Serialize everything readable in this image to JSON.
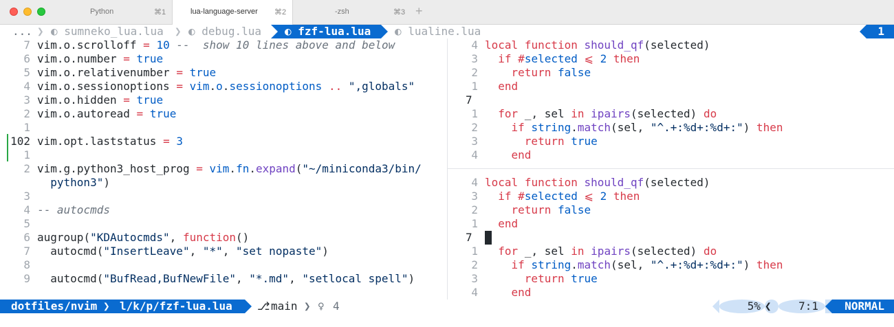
{
  "window": {
    "tabs": [
      {
        "name": "Python",
        "key": "⌘1"
      },
      {
        "name": "lua-language-server",
        "key": "⌘2"
      },
      {
        "name": "-zsh",
        "key": "⌘3"
      }
    ],
    "new_tab": "+"
  },
  "bufferline": {
    "ellipsis": "...",
    "buffers": [
      {
        "icon": "lua-icon",
        "name": "sumneko_lua.lua"
      },
      {
        "icon": "lua-icon",
        "name": "debug.lua"
      },
      {
        "icon": "lua-icon",
        "name": "fzf-lua.lua"
      },
      {
        "icon": "lua-icon",
        "name": "lualine.lua"
      }
    ],
    "count": "1"
  },
  "left_pane": {
    "lines": [
      {
        "ln": "7",
        "code": "vim.o.scrolloff = 10 --  show 10 lines above and below"
      },
      {
        "ln": "6",
        "code": "vim.o.number = true"
      },
      {
        "ln": "5",
        "code": "vim.o.relativenumber = true"
      },
      {
        "ln": "4",
        "code": "vim.o.sessionoptions = vim.o.sessionoptions .. \",globals\""
      },
      {
        "ln": "3",
        "code": "vim.o.hidden = true"
      },
      {
        "ln": "2",
        "code": "vim.o.autoread = true"
      },
      {
        "ln": "1",
        "code": ""
      },
      {
        "ln": "102",
        "code": "vim.opt.laststatus = 3"
      },
      {
        "ln": "1",
        "code": ""
      },
      {
        "ln": "2",
        "code": "vim.g.python3_host_prog = vim.fn.expand(\"~/miniconda3/bin/"
      },
      {
        "ln": "",
        "code": "  python3\")"
      },
      {
        "ln": "3",
        "code": ""
      },
      {
        "ln": "4",
        "code": "-- autocmds"
      },
      {
        "ln": "5",
        "code": ""
      },
      {
        "ln": "6",
        "code": "augroup(\"KDAutocmds\", function()"
      },
      {
        "ln": "7",
        "code": "  autocmd(\"InsertLeave\", \"*\", \"set nopaste\")"
      },
      {
        "ln": "8",
        "code": ""
      },
      {
        "ln": "9",
        "code": "  autocmd(\"BufRead,BufNewFile\", \"*.md\", \"setlocal spell\")"
      }
    ]
  },
  "right_top": {
    "lines": [
      {
        "ln": "4",
        "code": "local function should_qf(selected)"
      },
      {
        "ln": "3",
        "code": "  if #selected ⩽ 2 then"
      },
      {
        "ln": "2",
        "code": "    return false"
      },
      {
        "ln": "1",
        "code": "  end"
      },
      {
        "ln": "7",
        "code": ""
      },
      {
        "ln": "1",
        "code": "  for _, sel in ipairs(selected) do"
      },
      {
        "ln": "2",
        "code": "    if string.match(sel, \"^.+:%d+:%d+:\") then"
      },
      {
        "ln": "3",
        "code": "      return true"
      },
      {
        "ln": "4",
        "code": "    end"
      }
    ]
  },
  "right_bottom": {
    "lines": [
      {
        "ln": "4",
        "code": "local function should_qf(selected)"
      },
      {
        "ln": "3",
        "code": "  if #selected ⩽ 2 then"
      },
      {
        "ln": "2",
        "code": "    return false"
      },
      {
        "ln": "1",
        "code": "  end"
      },
      {
        "ln": "7",
        "code": ""
      },
      {
        "ln": "1",
        "code": "  for _, sel in ipairs(selected) do"
      },
      {
        "ln": "2",
        "code": "    if string.match(sel, \"^.+:%d+:%d+:\") then"
      },
      {
        "ln": "3",
        "code": "      return true"
      },
      {
        "ln": "4",
        "code": "    end"
      }
    ]
  },
  "statusline": {
    "cwd": "dotfiles/nvim",
    "file": "l/k/p/fzf-lua.lua",
    "branch_icon": "git-branch-icon",
    "branch": "main",
    "lsp_icon": "lightbulb-icon",
    "lsp_count": "4",
    "progress": "5%",
    "position": "7:1",
    "mode": "NORMAL"
  },
  "colors": {
    "accent": "#0a6bd0",
    "accent_light": "#cfe2f7",
    "keyword": "#d73a49",
    "function": "#6f42c1",
    "string": "#032f62",
    "number": "#005cc5",
    "comment": "#6a737d",
    "git_added": "#28a745"
  }
}
